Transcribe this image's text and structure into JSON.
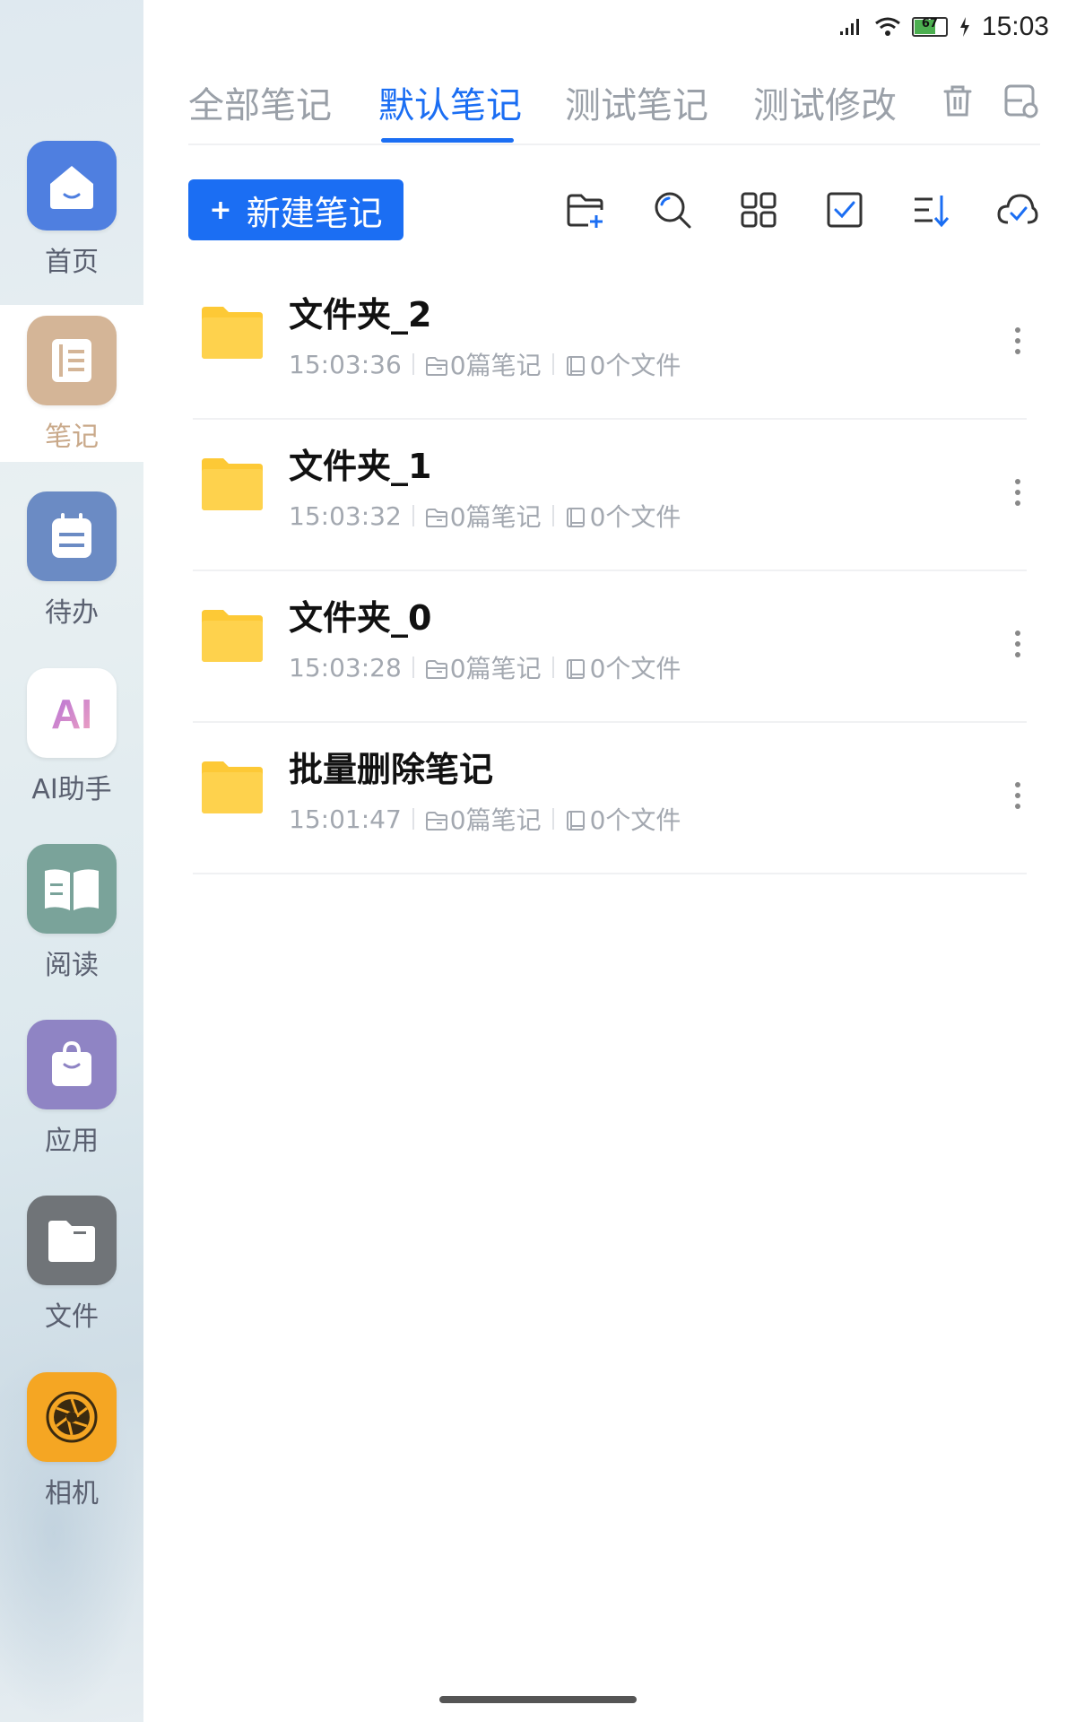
{
  "status_bar": {
    "time": "15:03",
    "battery": "67"
  },
  "sidebar": {
    "items": [
      {
        "id": "home",
        "label": "首页",
        "icon": "home-icon",
        "color": "#4f7fe0"
      },
      {
        "id": "notes",
        "label": "笔记",
        "icon": "notebook-icon",
        "color": "#c9a98a",
        "active": true
      },
      {
        "id": "todo",
        "label": "待办",
        "icon": "calendar-icon",
        "color": "#6b8bc4"
      },
      {
        "id": "ai",
        "label": "AI助手",
        "icon": "ai-icon",
        "color": "#ffffff",
        "glyph": "AI"
      },
      {
        "id": "read",
        "label": "阅读",
        "icon": "book-icon",
        "color": "#7aa39a"
      },
      {
        "id": "apps",
        "label": "应用",
        "icon": "bag-icon",
        "color": "#8f84c4"
      },
      {
        "id": "files",
        "label": "文件",
        "icon": "folder-icon",
        "color": "#6f7378"
      },
      {
        "id": "camera",
        "label": "相机",
        "icon": "camera-icon",
        "color": "#f5a623"
      }
    ]
  },
  "tabs": [
    {
      "label": "全部笔记",
      "active": false
    },
    {
      "label": "默认笔记",
      "active": true
    },
    {
      "label": "测试笔记",
      "active": false
    },
    {
      "label": "测试修改",
      "active": false
    }
  ],
  "toolbar": {
    "new_note_label": "新建笔记",
    "icons": [
      "new-folder-icon",
      "search-icon",
      "grid-view-icon",
      "select-icon",
      "sort-icon",
      "cloud-sync-icon"
    ]
  },
  "folders": [
    {
      "name": "文件夹_2",
      "time": "15:03:36",
      "notes": "0篇笔记",
      "files": "0个文件"
    },
    {
      "name": "文件夹_1",
      "time": "15:03:32",
      "notes": "0篇笔记",
      "files": "0个文件"
    },
    {
      "name": "文件夹_0",
      "time": "15:03:28",
      "notes": "0篇笔记",
      "files": "0个文件"
    },
    {
      "name": "批量删除笔记",
      "time": "15:01:47",
      "notes": "0篇笔记",
      "files": "0个文件"
    }
  ],
  "colors": {
    "accent": "#1b6ef3",
    "folder": "#fdc936"
  }
}
